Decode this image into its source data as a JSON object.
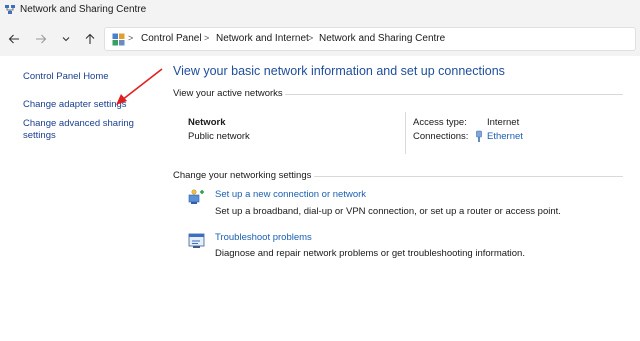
{
  "window": {
    "title": "Network and Sharing Centre",
    "icon": "network-sharing-icon"
  },
  "navigation": {
    "back_icon": "arrow-left-icon",
    "forward_icon": "arrow-right-icon",
    "recent_icon": "chevron-down-icon",
    "up_icon": "arrow-up-icon"
  },
  "address_bar": {
    "icon": "control-panel-icon",
    "crumbs": [
      "Control Panel",
      "Network and Internet",
      "Network and Sharing Centre"
    ],
    "separator": ">"
  },
  "left_pane": {
    "links": [
      "Control Panel Home",
      "Change adapter settings",
      "Change advanced sharing settings"
    ],
    "advanced_line1": "Change advanced sharing",
    "advanced_line2": "settings"
  },
  "main": {
    "heading": "View your basic network information and set up connections",
    "active_networks_label": "View your active networks",
    "network": {
      "name": "Network",
      "type": "Public network",
      "access_type_label": "Access type:",
      "access_type_value": "Internet",
      "connections_label": "Connections:",
      "connections_value": "Ethernet"
    },
    "change_settings_label": "Change your networking settings",
    "tasks": [
      {
        "icon": "new-connection-icon",
        "title": "Set up a new connection or network",
        "description": "Set up a broadband, dial-up or VPN connection, or set up a router or access point."
      },
      {
        "icon": "troubleshoot-icon",
        "title": "Troubleshoot problems",
        "description": "Diagnose and repair network problems or get troubleshooting information."
      }
    ]
  },
  "colors": {
    "link": "#1a5fb4",
    "heading": "#1f4e9c",
    "annotation_arrow": "#e02020",
    "chrome": "#f3f3f3"
  }
}
